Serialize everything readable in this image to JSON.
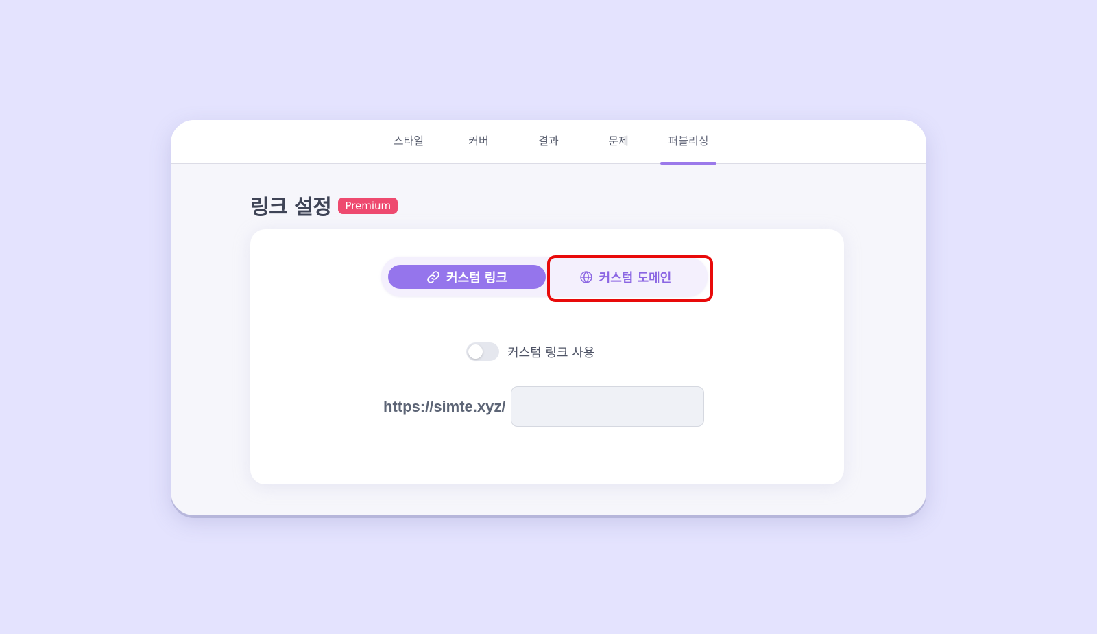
{
  "tabs": [
    {
      "label": "스타일",
      "active": false
    },
    {
      "label": "커버",
      "active": false
    },
    {
      "label": "결과",
      "active": false
    },
    {
      "label": "문제",
      "active": false
    },
    {
      "label": "퍼블리싱",
      "active": true
    }
  ],
  "section": {
    "title": "링크 설정",
    "badge": "Premium"
  },
  "segmented": {
    "custom_link_label": "커스텀 링크",
    "custom_link_icon": "link-icon",
    "custom_domain_label": "커스텀 도메인",
    "custom_domain_icon": "globe-icon",
    "selected": "custom_link"
  },
  "toggle": {
    "label": "커스텀 링크 사용",
    "on": false
  },
  "url": {
    "prefix": "https://simte.xyz/",
    "value": "",
    "placeholder": ""
  },
  "colors": {
    "background": "#e4e3fe",
    "accent": "#9575ec",
    "badge": "#ee4a6f",
    "highlight": "#e80a0a"
  }
}
